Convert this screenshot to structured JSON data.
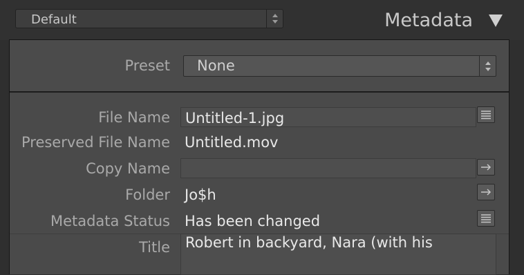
{
  "header": {
    "preset_value": "Default",
    "panel_title": "Metadata"
  },
  "preset_row": {
    "label": "Preset",
    "value": "None"
  },
  "fields": {
    "file_name": {
      "label": "File Name",
      "value": "Untitled-1.jpg"
    },
    "preserved_file_name": {
      "label": "Preserved File Name",
      "value": "Untitled.mov"
    },
    "copy_name": {
      "label": "Copy Name",
      "value": ""
    },
    "folder": {
      "label": "Folder",
      "value": "Jo$h"
    },
    "metadata_status": {
      "label": "Metadata Status",
      "value": "Has been changed"
    },
    "title": {
      "label": "Title",
      "value": "Robert in backyard, Nara (with his"
    }
  },
  "icons": {
    "list": "list-icon",
    "arrow": "arrow-right-icon",
    "stepper": "up-down-stepper-icon",
    "collapse": "triangle-down-icon"
  }
}
